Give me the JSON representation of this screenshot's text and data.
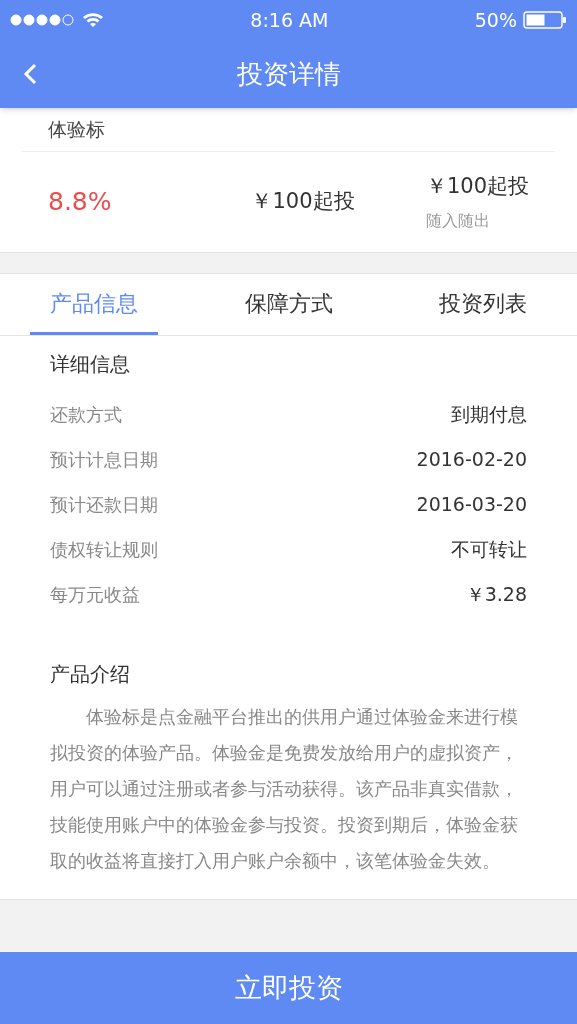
{
  "status_bar": {
    "time": "8:16 AM",
    "battery": "50%"
  },
  "nav": {
    "title": "投资详情"
  },
  "product": {
    "name": "体验标",
    "rate": "8.8%",
    "min_invest": "￥100起投",
    "right_amount": "￥100起投",
    "right_note": "随入随出"
  },
  "tabs": [
    {
      "label": "产品信息",
      "selected": true
    },
    {
      "label": "保障方式",
      "selected": false
    },
    {
      "label": "投资列表",
      "selected": false
    }
  ],
  "details": {
    "title": "详细信息",
    "rows": [
      {
        "label": "还款方式",
        "value": "到期付息"
      },
      {
        "label": "预计计息日期",
        "value": "2016-02-20"
      },
      {
        "label": "预计还款日期",
        "value": "2016-03-20"
      },
      {
        "label": "债权转让规则",
        "value": "不可转让"
      },
      {
        "label": "每万元收益",
        "value": "￥3.28"
      }
    ]
  },
  "intro": {
    "title": "产品介绍",
    "text": "体验标是点金融平台推出的供用户通过体验金来进行模拟投资的体验产品。体验金是免费发放给用户的虚拟资产，用户可以通过注册或者参与活动获得。该产品非真实借款，技能使用账户中的体验金参与投资。投资到期后，体验金获取的收益将直接打入用户账户余额中，该笔体验金失效。"
  },
  "action_button": "立即投资"
}
